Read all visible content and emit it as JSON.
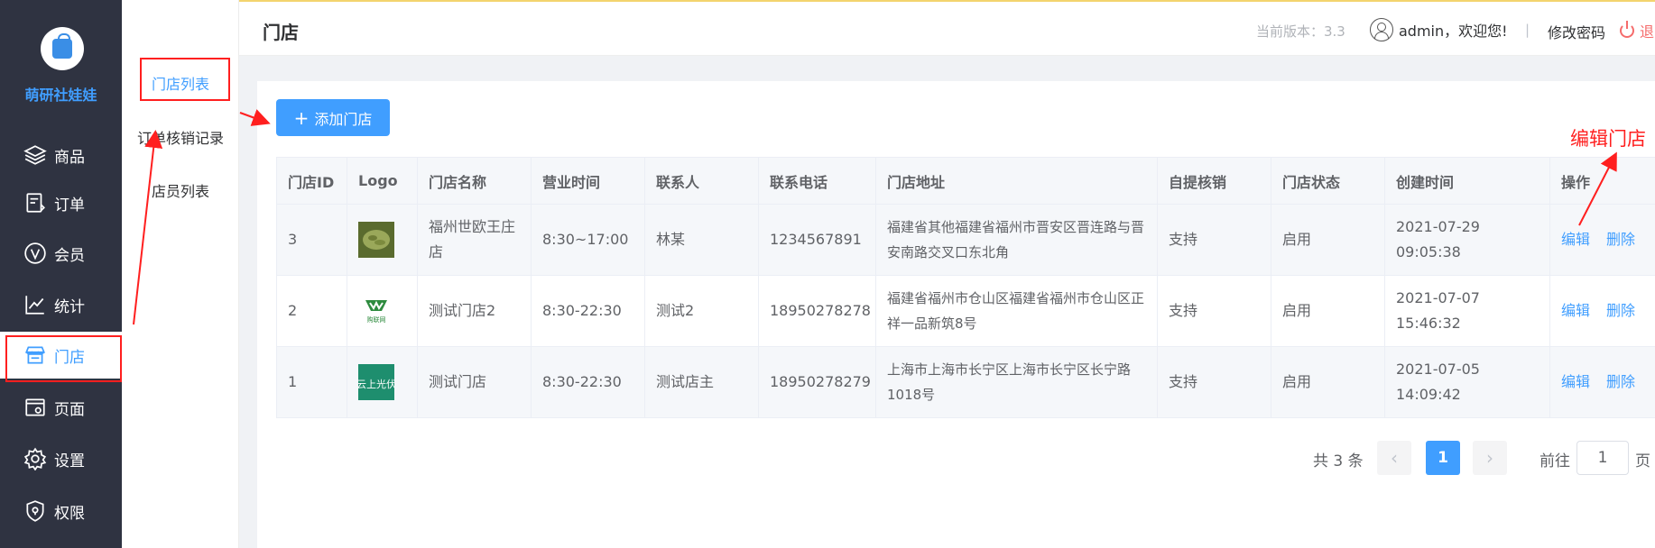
{
  "brand": {
    "name": "萌研社娃娃"
  },
  "sidebar": {
    "items": [
      {
        "label": "商品",
        "icon": "layers-icon"
      },
      {
        "label": "订单",
        "icon": "order-doc-icon"
      },
      {
        "label": "会员",
        "icon": "vip-icon"
      },
      {
        "label": "统计",
        "icon": "chart-line-icon"
      },
      {
        "label": "门店",
        "icon": "store-icon",
        "active": true
      },
      {
        "label": "页面",
        "icon": "page-window-icon"
      },
      {
        "label": "设置",
        "icon": "gear-icon"
      },
      {
        "label": "权限",
        "icon": "shield-icon"
      }
    ]
  },
  "subnav": {
    "items": [
      {
        "label": "门店列表",
        "active": true
      },
      {
        "label": "订单核销记录"
      },
      {
        "label": "店员列表"
      }
    ]
  },
  "header": {
    "title": "门店",
    "version": "当前版本：3.3",
    "user": "admin，欢迎您!",
    "divider": "|",
    "change_password": "修改密码",
    "logout": "退"
  },
  "toolbar": {
    "add_label": "添加门店"
  },
  "table": {
    "columns": [
      "门店ID",
      "Logo",
      "门店名称",
      "营业时间",
      "联系人",
      "联系电话",
      "门店地址",
      "自提核销",
      "门店状态",
      "创建时间",
      "操作"
    ],
    "rows": [
      {
        "id": "3",
        "logo": "tea-leaves-logo",
        "name": "福州世欧王庄店",
        "hours": "8:30~17:00",
        "contact": "林某",
        "phone": "1234567891",
        "address": "福建省其他福建省福州市晋安区晋连路与晋安南路交叉口东北角",
        "pickup": "支持",
        "status": "启用",
        "created": "2021-07-29 09:05:38",
        "edit": "编辑",
        "delete": "删除"
      },
      {
        "id": "2",
        "logo": "gouliangwang-logo",
        "logo_text": "购联网",
        "name": "测试门店2",
        "hours": "8:30-22:30",
        "contact": "测试2",
        "phone": "18950278278",
        "address": "福建省福州市仓山区福建省福州市仓山区正祥一品新筑8号",
        "pickup": "支持",
        "status": "启用",
        "created": "2021-07-07 15:46:32",
        "edit": "编辑",
        "delete": "删除"
      },
      {
        "id": "1",
        "logo": "yunshang-guangfu-logo",
        "logo_text": "云上光伏",
        "name": "测试门店",
        "hours": "8:30-22:30",
        "contact": "测试店主",
        "phone": "18950278279",
        "address": "上海市上海市长宁区上海市长宁区长宁路1018号",
        "pickup": "支持",
        "status": "启用",
        "created": "2021-07-05 14:09:42",
        "edit": "编辑",
        "delete": "删除"
      }
    ]
  },
  "pagination": {
    "total_text": "共 3 条",
    "prev": "‹",
    "current": "1",
    "next": "›",
    "goto_label": "前往",
    "goto_value": "1",
    "goto_suffix": "页"
  },
  "annotation": {
    "text": "编辑门店",
    "color": "#ff1f1f"
  },
  "colors": {
    "primary": "#409eff",
    "sidebar": "#2f3341",
    "success": "#67c23a",
    "danger": "#f56c6c"
  }
}
